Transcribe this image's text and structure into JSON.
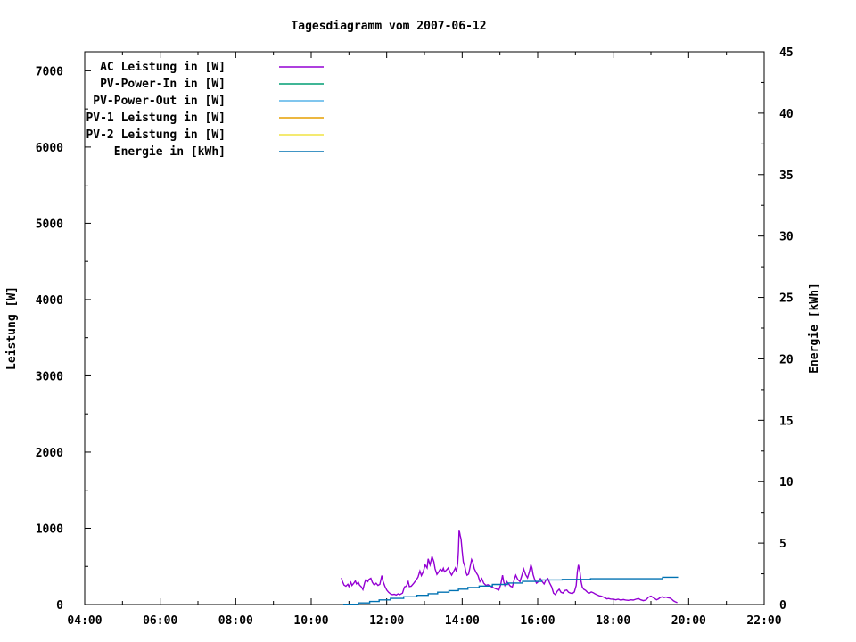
{
  "page": {
    "background": "#ffffff",
    "foreground": "#000000"
  },
  "chart_data": {
    "type": "line",
    "title": "Tagesdiagramm vom 2007-06-12",
    "xlabel": "",
    "ylabel": "Leistung [W]",
    "y2label": "Energie [kWh]",
    "grid": false,
    "legend_position": "top-left-inside",
    "x_axis": {
      "unit": "time",
      "range_hours": [
        4,
        22
      ],
      "major_tick_step_hours": 2,
      "minor_tick_step_hours": 1,
      "tick_labels": [
        "04:00",
        "06:00",
        "08:00",
        "10:00",
        "12:00",
        "14:00",
        "16:00",
        "18:00",
        "20:00",
        "22:00"
      ]
    },
    "y_axis_left": {
      "label": "Leistung [W]",
      "range": [
        0,
        7250
      ],
      "major_ticks": [
        0,
        1000,
        2000,
        3000,
        4000,
        5000,
        6000,
        7000
      ],
      "minor_tick_step": 500
    },
    "y_axis_right": {
      "label": "Energie [kWh]",
      "range": [
        0,
        45
      ],
      "major_ticks": [
        0,
        5,
        10,
        15,
        20,
        25,
        30,
        35,
        40,
        45
      ],
      "minor_tick_step": 2.5
    },
    "series": [
      {
        "name": "AC Leistung in [W]",
        "color": "#9400d3",
        "axis": "left",
        "style": "line",
        "points": [
          [
            10.8,
            350
          ],
          [
            10.83,
            300
          ],
          [
            10.87,
            255
          ],
          [
            10.92,
            240
          ],
          [
            10.97,
            265
          ],
          [
            11.0,
            235
          ],
          [
            11.05,
            290
          ],
          [
            11.08,
            250
          ],
          [
            11.13,
            280
          ],
          [
            11.17,
            310
          ],
          [
            11.2,
            270
          ],
          [
            11.25,
            290
          ],
          [
            11.28,
            255
          ],
          [
            11.33,
            230
          ],
          [
            11.37,
            195
          ],
          [
            11.42,
            290
          ],
          [
            11.45,
            330
          ],
          [
            11.5,
            300
          ],
          [
            11.53,
            330
          ],
          [
            11.58,
            345
          ],
          [
            11.62,
            290
          ],
          [
            11.67,
            255
          ],
          [
            11.72,
            280
          ],
          [
            11.77,
            250
          ],
          [
            11.82,
            265
          ],
          [
            11.87,
            380
          ],
          [
            11.9,
            310
          ],
          [
            11.95,
            240
          ],
          [
            12.0,
            190
          ],
          [
            12.05,
            160
          ],
          [
            12.1,
            140
          ],
          [
            12.15,
            130
          ],
          [
            12.2,
            135
          ],
          [
            12.25,
            125
          ],
          [
            12.3,
            140
          ],
          [
            12.35,
            130
          ],
          [
            12.42,
            150
          ],
          [
            12.47,
            230
          ],
          [
            12.52,
            240
          ],
          [
            12.57,
            300
          ],
          [
            12.6,
            235
          ],
          [
            12.65,
            240
          ],
          [
            12.72,
            280
          ],
          [
            12.78,
            320
          ],
          [
            12.83,
            360
          ],
          [
            12.88,
            440
          ],
          [
            12.92,
            380
          ],
          [
            12.97,
            430
          ],
          [
            13.02,
            520
          ],
          [
            13.07,
            480
          ],
          [
            13.1,
            600
          ],
          [
            13.15,
            520
          ],
          [
            13.2,
            630
          ],
          [
            13.25,
            560
          ],
          [
            13.28,
            470
          ],
          [
            13.33,
            395
          ],
          [
            13.38,
            430
          ],
          [
            13.42,
            465
          ],
          [
            13.47,
            440
          ],
          [
            13.5,
            475
          ],
          [
            13.53,
            430
          ],
          [
            13.58,
            450
          ],
          [
            13.63,
            480
          ],
          [
            13.68,
            420
          ],
          [
            13.72,
            385
          ],
          [
            13.77,
            430
          ],
          [
            13.82,
            480
          ],
          [
            13.85,
            430
          ],
          [
            13.88,
            540
          ],
          [
            13.9,
            700
          ],
          [
            13.92,
            980
          ],
          [
            13.95,
            900
          ],
          [
            13.97,
            855
          ],
          [
            14.0,
            700
          ],
          [
            14.03,
            560
          ],
          [
            14.07,
            500
          ],
          [
            14.1,
            420
          ],
          [
            14.13,
            385
          ],
          [
            14.17,
            400
          ],
          [
            14.2,
            470
          ],
          [
            14.25,
            590
          ],
          [
            14.28,
            560
          ],
          [
            14.32,
            470
          ],
          [
            14.37,
            420
          ],
          [
            14.42,
            380
          ],
          [
            14.47,
            300
          ],
          [
            14.52,
            340
          ],
          [
            14.57,
            280
          ],
          [
            14.63,
            250
          ],
          [
            14.68,
            260
          ],
          [
            14.73,
            245
          ],
          [
            14.78,
            230
          ],
          [
            14.85,
            215
          ],
          [
            14.92,
            200
          ],
          [
            14.97,
            190
          ],
          [
            15.02,
            260
          ],
          [
            15.07,
            385
          ],
          [
            15.1,
            300
          ],
          [
            15.13,
            250
          ],
          [
            15.18,
            300
          ],
          [
            15.23,
            270
          ],
          [
            15.28,
            240
          ],
          [
            15.33,
            230
          ],
          [
            15.38,
            330
          ],
          [
            15.42,
            385
          ],
          [
            15.47,
            330
          ],
          [
            15.53,
            300
          ],
          [
            15.58,
            380
          ],
          [
            15.63,
            465
          ],
          [
            15.68,
            390
          ],
          [
            15.73,
            350
          ],
          [
            15.78,
            430
          ],
          [
            15.82,
            520
          ],
          [
            15.85,
            480
          ],
          [
            15.88,
            390
          ],
          [
            15.92,
            330
          ],
          [
            15.97,
            280
          ],
          [
            16.02,
            300
          ],
          [
            16.07,
            340
          ],
          [
            16.12,
            300
          ],
          [
            16.17,
            270
          ],
          [
            16.22,
            320
          ],
          [
            16.27,
            340
          ],
          [
            16.32,
            280
          ],
          [
            16.37,
            230
          ],
          [
            16.42,
            150
          ],
          [
            16.47,
            130
          ],
          [
            16.52,
            175
          ],
          [
            16.57,
            200
          ],
          [
            16.62,
            160
          ],
          [
            16.67,
            150
          ],
          [
            16.72,
            185
          ],
          [
            16.77,
            190
          ],
          [
            16.82,
            160
          ],
          [
            16.87,
            150
          ],
          [
            16.92,
            145
          ],
          [
            16.97,
            165
          ],
          [
            17.02,
            250
          ],
          [
            17.05,
            430
          ],
          [
            17.08,
            520
          ],
          [
            17.12,
            430
          ],
          [
            17.15,
            300
          ],
          [
            17.18,
            230
          ],
          [
            17.22,
            200
          ],
          [
            17.27,
            185
          ],
          [
            17.32,
            160
          ],
          [
            17.37,
            150
          ],
          [
            17.42,
            165
          ],
          [
            17.47,
            155
          ],
          [
            17.52,
            140
          ],
          [
            17.58,
            125
          ],
          [
            17.63,
            115
          ],
          [
            17.68,
            110
          ],
          [
            17.73,
            100
          ],
          [
            17.78,
            90
          ],
          [
            17.83,
            75
          ],
          [
            17.88,
            80
          ],
          [
            17.93,
            72
          ],
          [
            18.0,
            70
          ],
          [
            18.07,
            62
          ],
          [
            18.13,
            70
          ],
          [
            18.2,
            58
          ],
          [
            18.27,
            65
          ],
          [
            18.33,
            60
          ],
          [
            18.4,
            55
          ],
          [
            18.47,
            62
          ],
          [
            18.53,
            58
          ],
          [
            18.6,
            70
          ],
          [
            18.67,
            78
          ],
          [
            18.73,
            62
          ],
          [
            18.8,
            52
          ],
          [
            18.87,
            60
          ],
          [
            18.93,
            95
          ],
          [
            19.0,
            110
          ],
          [
            19.05,
            95
          ],
          [
            19.1,
            80
          ],
          [
            19.15,
            62
          ],
          [
            19.2,
            75
          ],
          [
            19.25,
            95
          ],
          [
            19.3,
            100
          ],
          [
            19.35,
            92
          ],
          [
            19.4,
            98
          ],
          [
            19.45,
            90
          ],
          [
            19.5,
            85
          ],
          [
            19.55,
            70
          ],
          [
            19.6,
            48
          ],
          [
            19.65,
            35
          ],
          [
            19.7,
            25
          ]
        ]
      },
      {
        "name": "PV-Power-In in [W]",
        "color": "#009e73",
        "axis": "left",
        "style": "line",
        "points": []
      },
      {
        "name": "PV-Power-Out in [W]",
        "color": "#56b4e9",
        "axis": "left",
        "style": "line",
        "points": []
      },
      {
        "name": "PV-1 Leistung in [W]",
        "color": "#e69f00",
        "axis": "left",
        "style": "line",
        "points": []
      },
      {
        "name": "PV-2 Leistung in [W]",
        "color": "#f0e442",
        "axis": "left",
        "style": "line",
        "points": []
      },
      {
        "name": "Energie in [kWh]",
        "color": "#0072b2",
        "axis": "right",
        "style": "steps",
        "points": [
          [
            10.85,
            0.02
          ],
          [
            11.25,
            0.13
          ],
          [
            11.55,
            0.25
          ],
          [
            11.8,
            0.38
          ],
          [
            12.1,
            0.5
          ],
          [
            12.45,
            0.63
          ],
          [
            12.8,
            0.75
          ],
          [
            13.1,
            0.88
          ],
          [
            13.35,
            1.0
          ],
          [
            13.65,
            1.13
          ],
          [
            13.9,
            1.25
          ],
          [
            14.15,
            1.38
          ],
          [
            14.45,
            1.5
          ],
          [
            14.8,
            1.63
          ],
          [
            15.2,
            1.75
          ],
          [
            15.6,
            1.88
          ],
          [
            16.1,
            2.0
          ],
          [
            16.65,
            2.05
          ],
          [
            17.4,
            2.1
          ],
          [
            19.31,
            2.22
          ],
          [
            19.72,
            2.22
          ]
        ]
      }
    ]
  }
}
